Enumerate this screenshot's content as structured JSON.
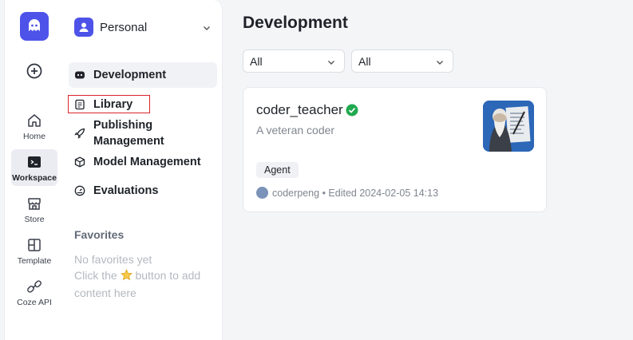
{
  "rail": {
    "items": [
      {
        "label": "Home",
        "icon": "home-icon"
      },
      {
        "label": "Workspace",
        "icon": "terminal-icon",
        "active": true
      },
      {
        "label": "Store",
        "icon": "store-icon"
      },
      {
        "label": "Template",
        "icon": "template-icon"
      },
      {
        "label": "Coze API",
        "icon": "api-link-icon"
      }
    ]
  },
  "sidebar": {
    "space_name": "Personal",
    "nav": [
      {
        "label": "Development",
        "icon": "robot-icon",
        "active": true
      },
      {
        "label": "Library",
        "icon": "book-icon"
      },
      {
        "label": "Publishing\nManagement",
        "icon": "rocket-icon"
      },
      {
        "label": "Model Management",
        "icon": "cube-icon"
      },
      {
        "label": "Evaluations",
        "icon": "gauge-icon"
      }
    ],
    "favorites": {
      "heading": "Favorites",
      "empty_line1": "No favorites yet",
      "empty_line2_before": "Click the",
      "empty_line2_after": "button to add",
      "empty_line3": "content here"
    }
  },
  "main": {
    "title": "Development",
    "filters": [
      {
        "value": "All"
      },
      {
        "value": "All"
      }
    ],
    "cards": [
      {
        "name": "coder_teacher",
        "description": "A veteran coder",
        "tag": "Agent",
        "author": "coderpeng",
        "edited": "• Edited 2024-02-05 14:13"
      }
    ]
  },
  "colors": {
    "brand": "#4d53e8",
    "highlight_box": "#d9252b",
    "verified": "#20a94f"
  }
}
